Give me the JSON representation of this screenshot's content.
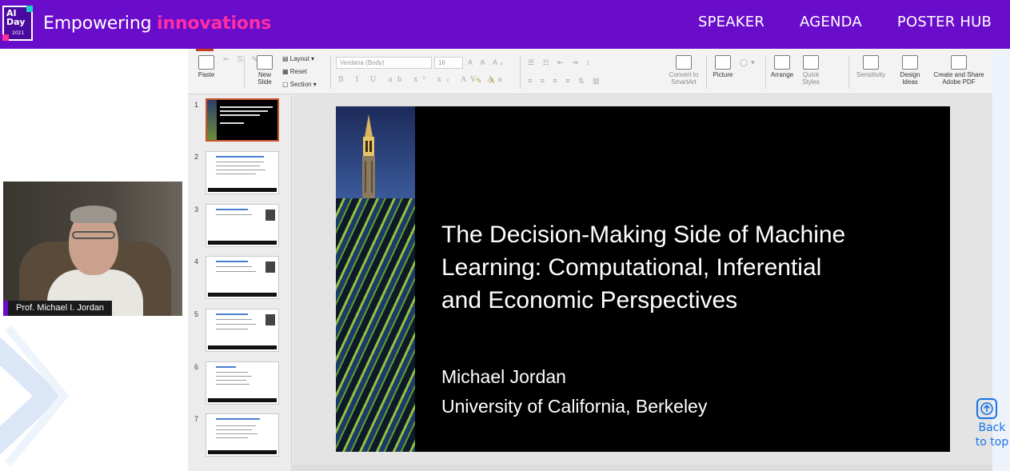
{
  "header": {
    "logo": {
      "line1": "AI",
      "line2": "Day",
      "line3": "2021"
    },
    "tagline_prefix": "Empowering ",
    "tagline_highlight": "innovations",
    "nav": [
      "SPEAKER",
      "AGENDA",
      "POSTER HUB"
    ]
  },
  "video": {
    "speaker_name": "Prof. Michael I. Jordan"
  },
  "ribbon": {
    "paste": "Paste",
    "new_slide": "New\nSlide",
    "layout": "Layout",
    "reset": "Reset",
    "section": "Section",
    "font_name": "Verdana (Body)",
    "font_size": "16",
    "convert": "Convert to\nSmartArt",
    "picture": "Picture",
    "arrange": "Arrange",
    "quick_styles": "Quick\nStyles",
    "sensitivity": "Sensitivity",
    "design_ideas": "Design\nIdeas",
    "create_share": "Create and Share\nAdobe PDF"
  },
  "thumbnails": [
    "1",
    "2",
    "3",
    "4",
    "5",
    "6",
    "7"
  ],
  "slide": {
    "title_lines": [
      "The Decision-Making Side of Machine",
      "Learning: Computational, Inferential",
      "and Economic Perspectives"
    ],
    "author": "Michael Jordan",
    "affiliation": "University of California, Berkeley"
  },
  "back_to_top": {
    "line1": "Back",
    "line2": "to top"
  },
  "colors": {
    "brand_purple": "#6a0dca",
    "brand_pink": "#ff2ea3",
    "link_blue": "#1a73e8"
  }
}
